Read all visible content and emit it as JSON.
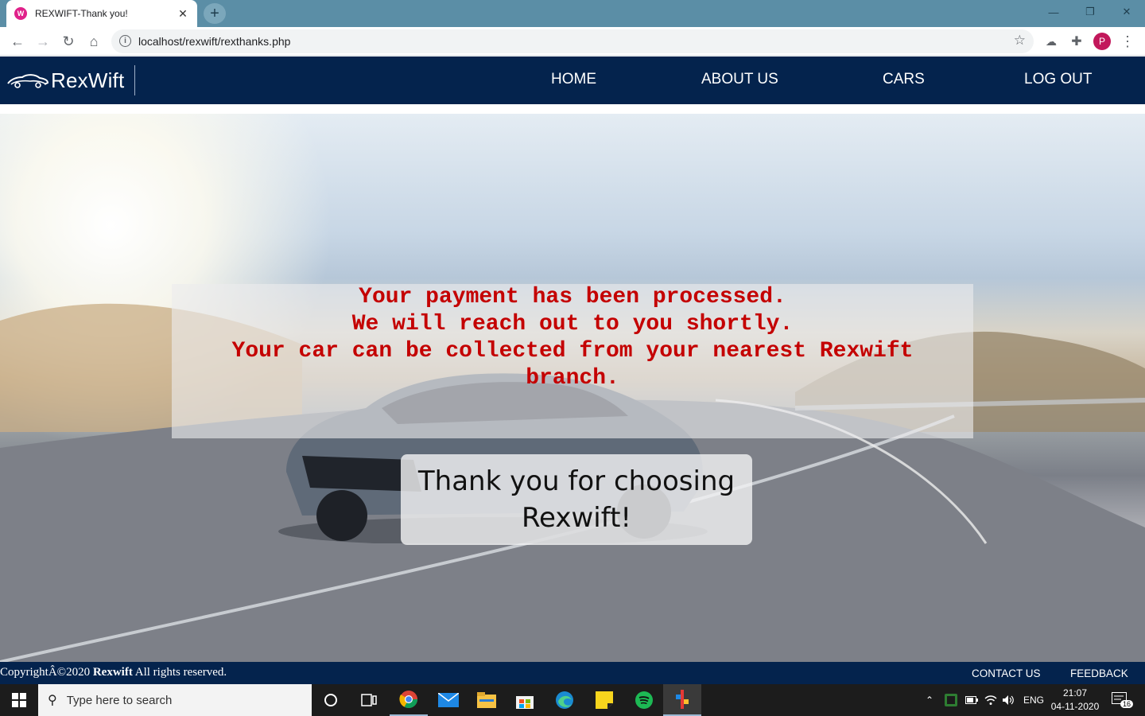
{
  "browser": {
    "tab_title": "REXWIFT-Thank you!",
    "favicon_icon": "rexwift-favicon",
    "url": "localhost/rexwift/rexthanks.php",
    "profile_initial": "P"
  },
  "navbar": {
    "logo_text": "RexWift",
    "links": [
      "HOME",
      "ABOUT US",
      "CARS",
      "LOG OUT"
    ]
  },
  "message": {
    "lines": [
      "Your payment has been processed.",
      "We will reach out to you shortly.",
      "Your car can be collected from your nearest Rexwift",
      "branch."
    ],
    "color": "#c40000"
  },
  "thanks": {
    "lines": [
      "Thank you for choosing",
      "Rexwift!"
    ]
  },
  "footer": {
    "copyright_prefix": "CopyrightÂ©2020",
    "brand": "Rexwift",
    "copyright_suffix": "All rights reserved.",
    "contact_label": "CONTACT US",
    "feedback_label": "FEEDBACK"
  },
  "taskbar": {
    "search_placeholder": "Type here to search",
    "language": "ENG",
    "time": "21:07",
    "date": "04-11-2020",
    "notification_count": "16"
  },
  "colors": {
    "navbar_bg": "#04234d",
    "tabstrip_bg": "#5b8ea6"
  }
}
